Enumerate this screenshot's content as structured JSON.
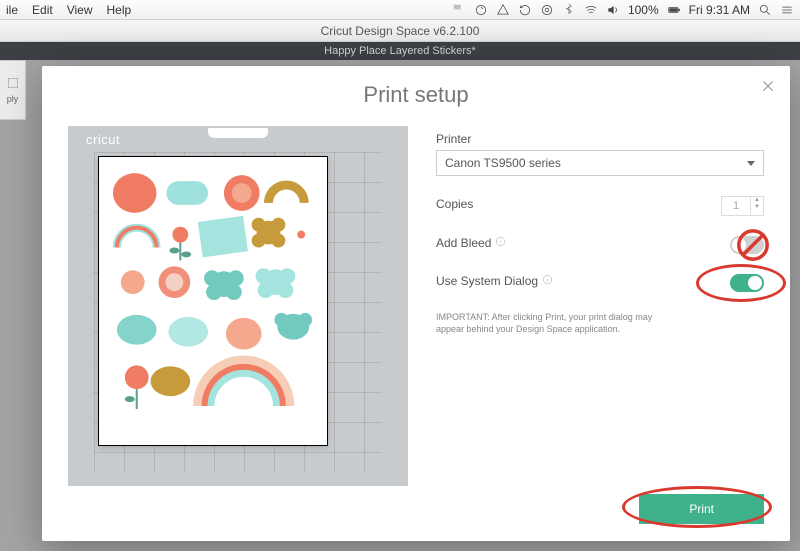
{
  "menubar": {
    "items": [
      "ile",
      "Edit",
      "View",
      "Help"
    ],
    "battery": "100%",
    "clock": "Fri 9:31 AM"
  },
  "window": {
    "title": "Cricut Design Space v6.2.100"
  },
  "appheader": {
    "project": "Happy Place Layered Stickers*"
  },
  "sidebar": {
    "label": "ply"
  },
  "modal": {
    "title": "Print setup",
    "mat_brand": "cricut",
    "printer": {
      "label": "Printer",
      "selected": "Canon TS9500 series"
    },
    "copies": {
      "label": "Copies",
      "value": "1"
    },
    "bleed": {
      "label": "Add Bleed",
      "on": false
    },
    "system_dialog": {
      "label": "Use System Dialog",
      "on": true
    },
    "note": "IMPORTANT: After clicking Print, your print dialog may appear behind your Design Space application.",
    "print_button": "Print"
  }
}
